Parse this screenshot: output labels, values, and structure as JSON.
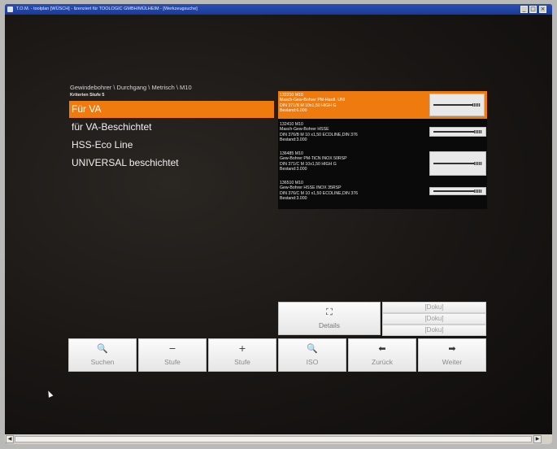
{
  "window": {
    "title": "T.O.M. - toolplan [WÜSCH] - lizenziert für TOOLOGIC GMBH/MÜLHEIM - [Werkzeugsuche]",
    "minimize": "_",
    "maximize": "□",
    "close": "×"
  },
  "breadcrumb": "Gewindebohrer \\ Durchgang \\ Metrisch \\ M10",
  "criteria_label": "Kriterien Stufe 5",
  "options": [
    {
      "label": "Für VA",
      "selected": true
    },
    {
      "label": "für VA-Beschichtet",
      "selected": false
    },
    {
      "label": "HSS-Eco Line",
      "selected": false
    },
    {
      "label": "UNIVERSAL beschichtet",
      "selected": false
    }
  ],
  "results": [
    {
      "line1": "132210 M10",
      "line2": "Masch-Gew-Bohrer PM-Hardl. UNI",
      "line3": "DIN 371/B M 10x1,50       HIGH G",
      "line4": "Bestand:6.000",
      "selected": true
    },
    {
      "line1": "132410 M10",
      "line2": "Masch-Gew-Bohrer HSSE",
      "line3": "DIN 376/B M 10 x1,50    ECOLINE,DIN 376",
      "line4": "Bestand:3.000",
      "selected": false
    },
    {
      "line1": "136485 M10",
      "line2": "Gew-Bohrer PM-TiCN INOX 50RSP",
      "line3": "DIN 371/C M 10x1,50       HIGH G",
      "line4": "Bestand:3.000",
      "selected": false
    },
    {
      "line1": "136510 M10",
      "line2": "Gew-Bohrer HSSE INOX 35RSP",
      "line3": "DIN 376/C M 10 x1,50    ECOLINE,DIN 376",
      "line4": "Bestand:3.000",
      "selected": false
    }
  ],
  "details_button": {
    "icon": "⛶",
    "label": "Details"
  },
  "doku_buttons": [
    "[Doku]",
    "[Doku]",
    "[Doku]"
  ],
  "toolbar": [
    {
      "icon": "🔍",
      "label": "Suchen",
      "name": "search-button",
      "icon_name": "magnifier-icon"
    },
    {
      "icon": "−",
      "label": "Stufe",
      "name": "stufe-minus-button",
      "icon_name": "minus-icon"
    },
    {
      "icon": "+",
      "label": "Stufe",
      "name": "stufe-plus-button",
      "icon_name": "plus-icon"
    },
    {
      "icon": "🔍",
      "label": "ISO",
      "name": "iso-button",
      "icon_name": "magnifier-icon"
    },
    {
      "icon": "⬅",
      "label": "Zurück",
      "name": "back-button",
      "icon_name": "arrow-left-icon"
    },
    {
      "icon": "➡",
      "label": "Weiter",
      "name": "next-button",
      "icon_name": "arrow-right-icon"
    }
  ],
  "colors": {
    "accent": "#ef7a0e",
    "titlebar": "#1a3a96",
    "background": "#141210"
  }
}
